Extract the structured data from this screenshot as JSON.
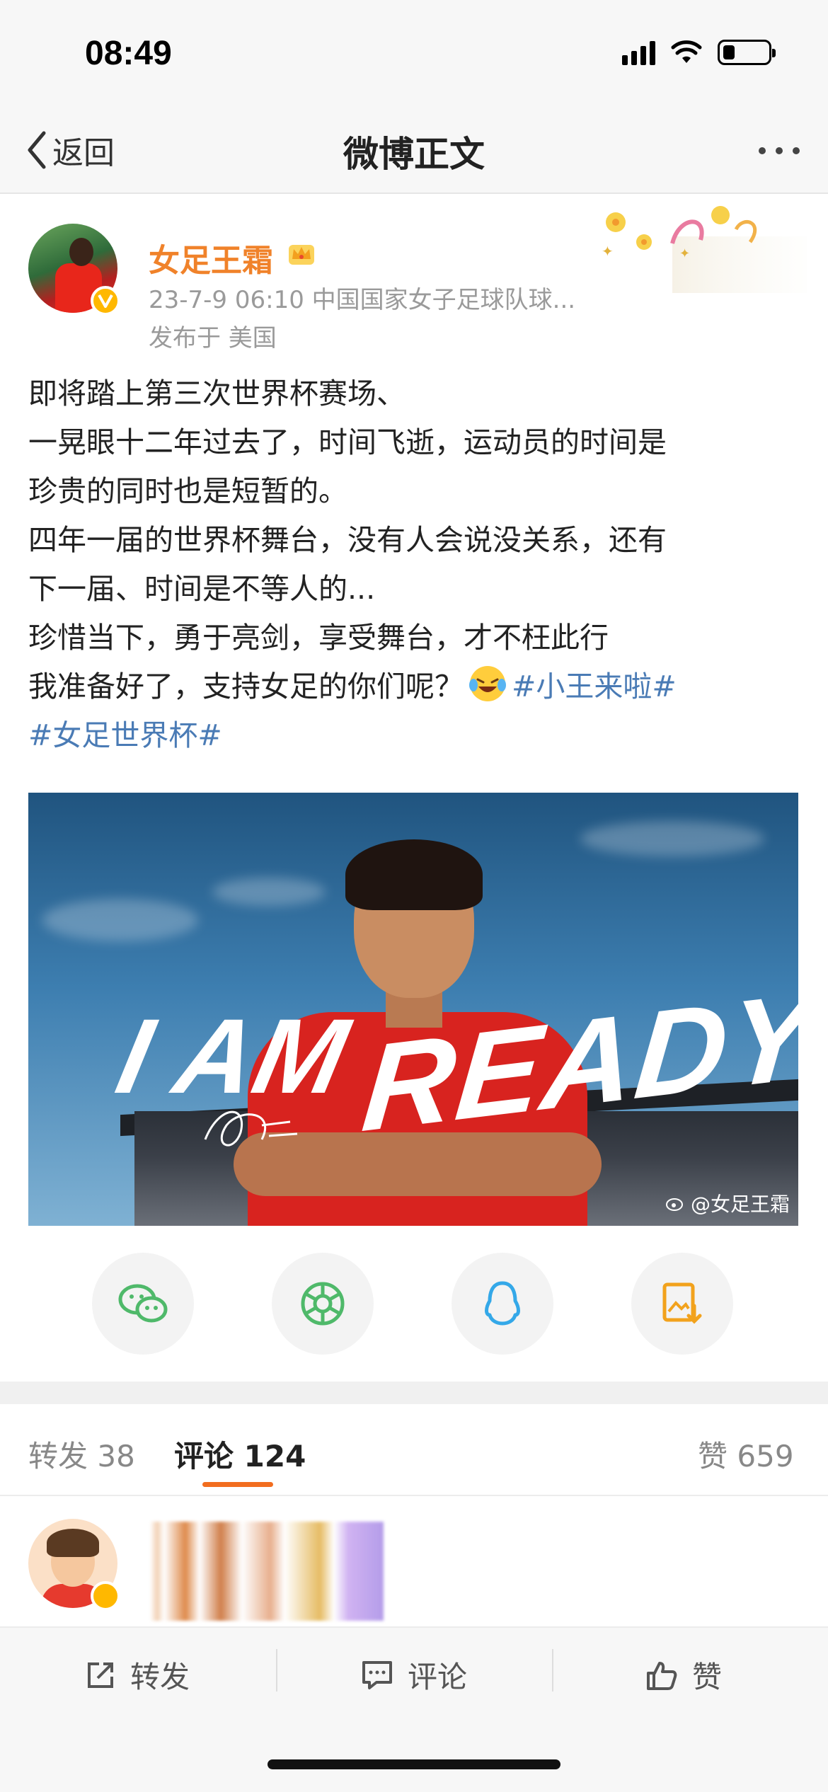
{
  "status_bar": {
    "time": "08:49",
    "battery_percent": 25
  },
  "nav": {
    "back_label": "返回",
    "title": "微博正文"
  },
  "post": {
    "author_name": "女足王霜",
    "meta": "23-7-9 06:10  中国国家女子足球队球...",
    "location": "发布于 美国",
    "lines": [
      "即将踏上第三次世界杯赛场、",
      "一晃眼十二年过去了，时间飞逝，运动员的时间是",
      "珍贵的同时也是短暂的。",
      "四年一届的世界杯舞台，没有人会说没关系，还有",
      "下一届、时间是不等人的...",
      "珍惜当下，勇于亮剑，享受舞台，才不枉此行",
      "我准备好了，支持女足的你们呢？"
    ],
    "hashtag_1": "#小王来啦#",
    "hashtag_2": "#女足世界杯#",
    "image": {
      "text_left": "I AM",
      "text_right": "READY!",
      "watermark": "@女足王霜"
    }
  },
  "share": [
    {
      "icon": "wechat-icon",
      "color": "#4fb96a"
    },
    {
      "icon": "moments-icon",
      "color": "#4fb96a"
    },
    {
      "icon": "qq-icon",
      "color": "#34a8e8"
    },
    {
      "icon": "save-image-icon",
      "color": "#f2a21c"
    }
  ],
  "tabs": {
    "repost_label": "转发",
    "repost_count": "38",
    "comment_label": "评论",
    "comment_count": "124",
    "like_label": "赞",
    "like_count": "659"
  },
  "actions": {
    "repost": "转发",
    "comment": "评论",
    "like": "赞"
  },
  "colors": {
    "accent": "#f26d1f",
    "author": "#f0822a",
    "hashtag": "#4a7bb5",
    "verified": "#ffb800"
  }
}
